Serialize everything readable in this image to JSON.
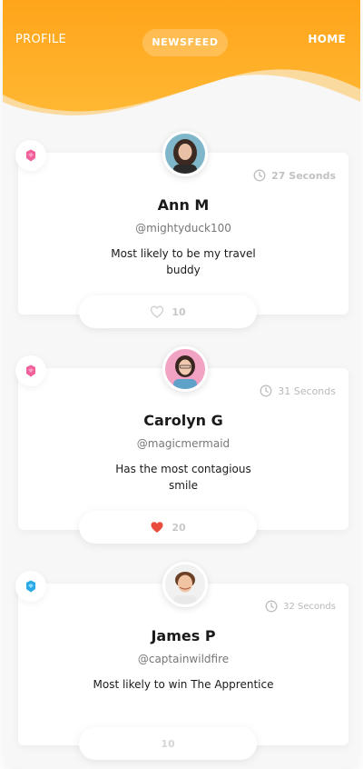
{
  "nav": {
    "profile": "PROFILE",
    "newsfeed": "NEWSFEED",
    "home": "HOME"
  },
  "colors": {
    "header_orange": "#ffad1f",
    "like_active": "#e74c3c",
    "badge_pink": "#f0609a",
    "badge_blue": "#29a9e6"
  },
  "posts": [
    {
      "name": "Ann M",
      "handle": "@mightyduck100",
      "quote": "Most likely to be my travel buddy",
      "time": "27 Seconds",
      "likes": "10",
      "liked": false,
      "badge": "pink-gem-icon"
    },
    {
      "name": "Carolyn G",
      "handle": "@magicmermaid",
      "quote": "Has the most contagious smile",
      "time": "31 Seconds",
      "likes": "20",
      "liked": true,
      "badge": "pink-gem-icon"
    },
    {
      "name": "James P",
      "handle": "@captainwildfire",
      "quote": "Most likely to win The Apprentice",
      "time": "32 Seconds",
      "likes": "10",
      "liked": false,
      "badge": "blue-gem-icon"
    }
  ]
}
